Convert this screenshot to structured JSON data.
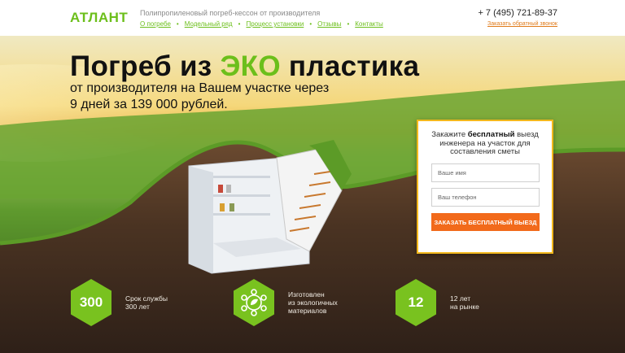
{
  "header": {
    "logo": "АТЛАНТ",
    "tagline": "Полипропиленовый погреб-кессон от производителя",
    "nav": [
      {
        "label": "О погребе"
      },
      {
        "label": "Модельный ряд"
      },
      {
        "label": "Процесс установки"
      },
      {
        "label": "Отзывы"
      },
      {
        "label": "Контакты"
      }
    ],
    "phone": "+ 7 (495) 721-89-37",
    "callback_label": "Заказать обратный звонок"
  },
  "hero": {
    "headline_part1": "Погреб из ",
    "headline_eco": "ЭКО",
    "headline_part2": " пластика",
    "subline": "от производителя на Вашем участке через 9 дней за 139 000 рублей."
  },
  "form": {
    "title_part1": "Закажите ",
    "title_bold": "бесплатный",
    "title_part2": " выезд инженера на участок для составления сметы",
    "name_placeholder": "Ваше имя",
    "phone_placeholder": "Ваш телефон",
    "submit_label": "ЗАКАЗАТЬ БЕСПЛАТНЫЙ ВЫЕЗД"
  },
  "features": [
    {
      "badge": "300",
      "icon": "",
      "line1": "Срок службы",
      "line2": "300 лет"
    },
    {
      "badge": "",
      "icon": "eco-molecule-icon",
      "line1": "Изготовлен",
      "line2": "из экологичных",
      "line3": "материалов"
    },
    {
      "badge": "12",
      "icon": "",
      "line1": "12 лет",
      "line2": "на рынке"
    }
  ],
  "colors": {
    "accent_green": "#6cbf1b",
    "cta_orange": "#f26a1b",
    "form_border": "#f3b81c",
    "soil": "#3b2a1e"
  }
}
